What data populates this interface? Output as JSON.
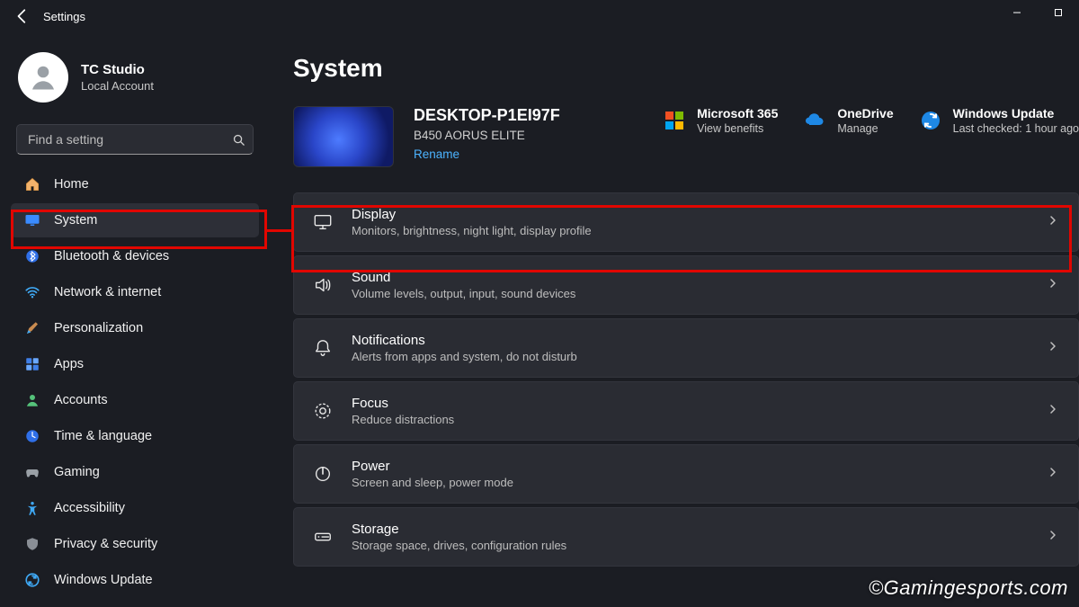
{
  "titlebar": {
    "title": "Settings"
  },
  "profile": {
    "name": "TC Studio",
    "subtitle": "Local Account"
  },
  "search": {
    "placeholder": "Find a setting"
  },
  "nav": {
    "items": [
      {
        "label": "Home"
      },
      {
        "label": "System"
      },
      {
        "label": "Bluetooth & devices"
      },
      {
        "label": "Network & internet"
      },
      {
        "label": "Personalization"
      },
      {
        "label": "Apps"
      },
      {
        "label": "Accounts"
      },
      {
        "label": "Time & language"
      },
      {
        "label": "Gaming"
      },
      {
        "label": "Accessibility"
      },
      {
        "label": "Privacy & security"
      },
      {
        "label": "Windows Update"
      }
    ],
    "active_index": 1
  },
  "main": {
    "page_title": "System",
    "device": {
      "name": "DESKTOP-P1EI97F",
      "model": "B450 AORUS ELITE",
      "rename_label": "Rename"
    },
    "promos": [
      {
        "title": "Microsoft 365",
        "sub": "View benefits"
      },
      {
        "title": "OneDrive",
        "sub": "Manage"
      },
      {
        "title": "Windows Update",
        "sub": "Last checked: 1 hour ago"
      }
    ],
    "cards": [
      {
        "title": "Display",
        "sub": "Monitors, brightness, night light, display profile"
      },
      {
        "title": "Sound",
        "sub": "Volume levels, output, input, sound devices"
      },
      {
        "title": "Notifications",
        "sub": "Alerts from apps and system, do not disturb"
      },
      {
        "title": "Focus",
        "sub": "Reduce distractions"
      },
      {
        "title": "Power",
        "sub": "Screen and sleep, power mode"
      },
      {
        "title": "Storage",
        "sub": "Storage space, drives, configuration rules"
      }
    ]
  },
  "watermark_text": "©Gamingesports.com"
}
